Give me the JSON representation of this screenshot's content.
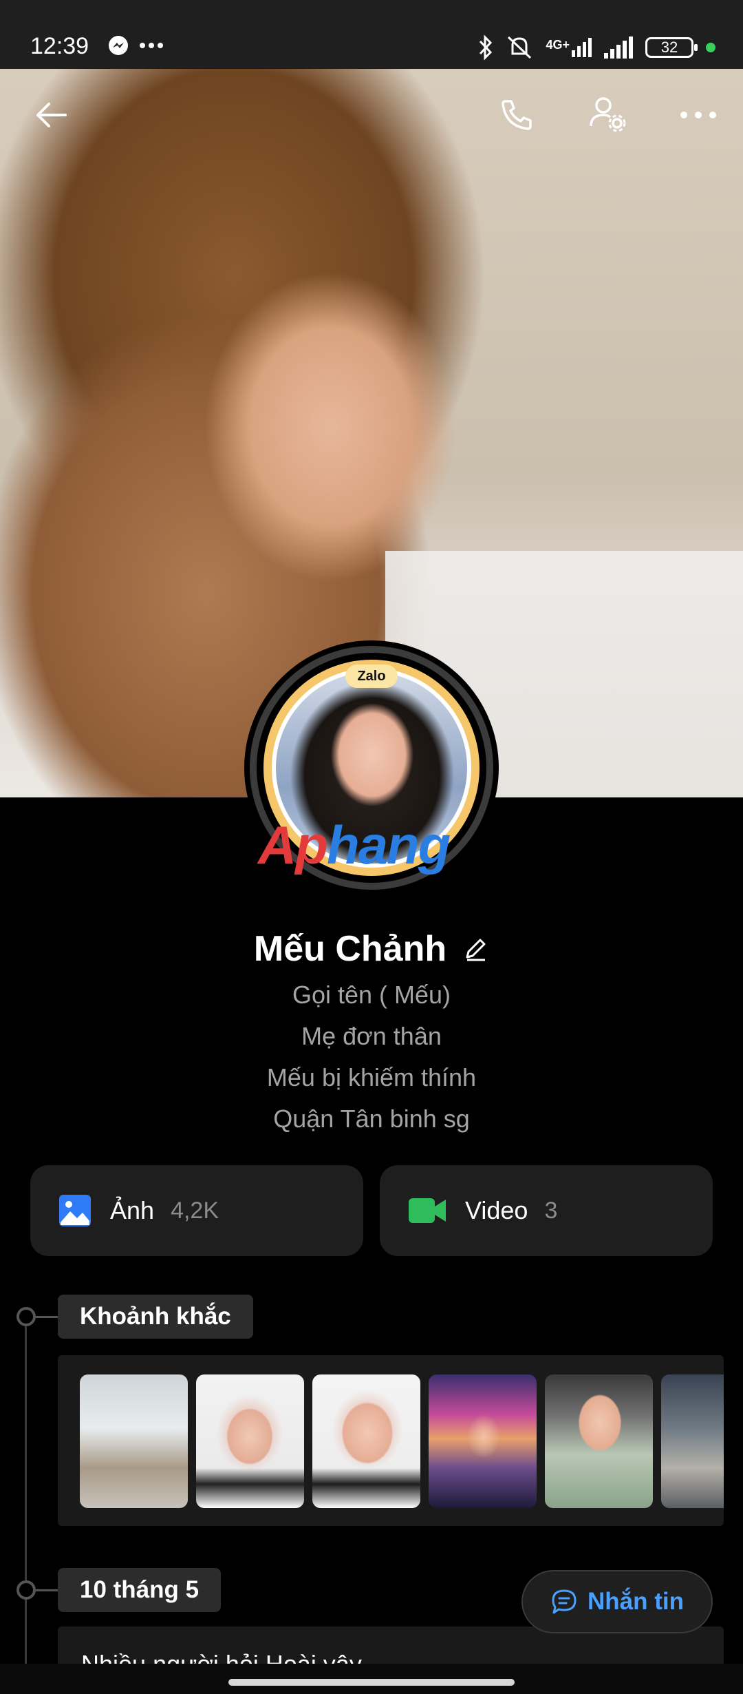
{
  "status_bar": {
    "time": "12:39",
    "battery": "32",
    "network_label": "4G+",
    "icons": [
      "messenger-icon",
      "more-dots-icon",
      "bluetooth-icon",
      "mute-icon",
      "signal-icon",
      "signal-icon",
      "battery-icon"
    ]
  },
  "top_bar": {
    "back_icon": "arrow-left-icon",
    "call_icon": "phone-icon",
    "settings_icon": "user-settings-icon",
    "more_icon": "more-horizontal-icon"
  },
  "avatar": {
    "badge": "Zalo",
    "watermark_part1": "Ap",
    "watermark_part2": "hang"
  },
  "profile": {
    "name": "Mếu Chảnh",
    "bio_lines": [
      "Gọi tên ( Mếu)",
      "Mẹ đơn thân",
      "Mếu bị khiếm thính",
      "Quận Tân binh sg"
    ]
  },
  "media": {
    "photos": {
      "label": "Ảnh",
      "count": "4,2K",
      "icon": "image-icon",
      "color": "#2f7bf5"
    },
    "videos": {
      "label": "Video",
      "count": "3",
      "icon": "video-camera-icon",
      "color": "#2fbd5c"
    }
  },
  "timeline": {
    "moments_label": "Khoảnh khắc",
    "date_label": "10 tháng 5",
    "post_preview": "Nhiều người hỏi Hoài vậy"
  },
  "chat_button": {
    "label": "Nhắn tin",
    "icon": "chat-bubble-icon"
  },
  "colors": {
    "accent_blue": "#4aa0ff",
    "avatar_ring": "#f6c66a",
    "background": "#000000"
  }
}
